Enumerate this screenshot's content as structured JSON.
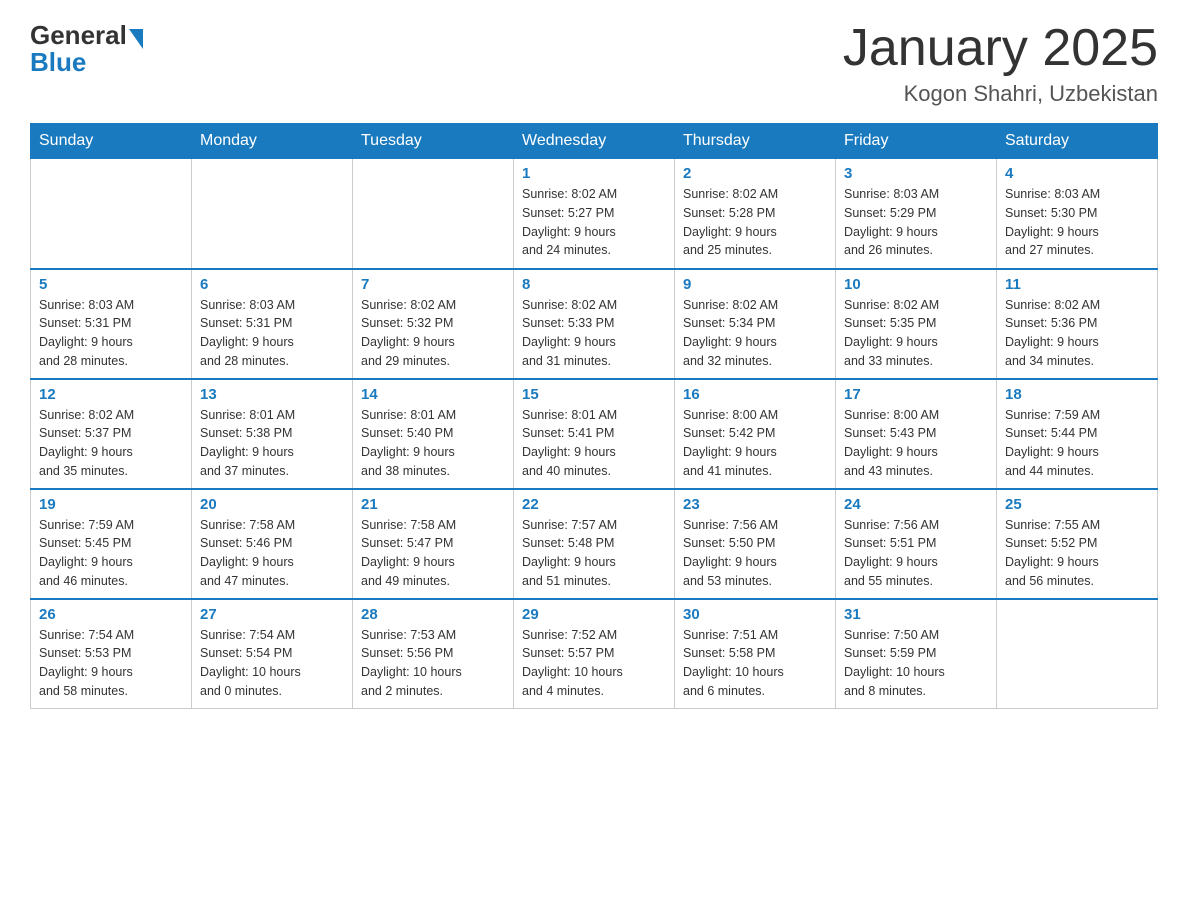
{
  "header": {
    "logo_general": "General",
    "logo_blue": "Blue",
    "title": "January 2025",
    "subtitle": "Kogon Shahri, Uzbekistan"
  },
  "columns": [
    "Sunday",
    "Monday",
    "Tuesday",
    "Wednesday",
    "Thursday",
    "Friday",
    "Saturday"
  ],
  "weeks": [
    [
      {
        "day": "",
        "info": ""
      },
      {
        "day": "",
        "info": ""
      },
      {
        "day": "",
        "info": ""
      },
      {
        "day": "1",
        "info": "Sunrise: 8:02 AM\nSunset: 5:27 PM\nDaylight: 9 hours\nand 24 minutes."
      },
      {
        "day": "2",
        "info": "Sunrise: 8:02 AM\nSunset: 5:28 PM\nDaylight: 9 hours\nand 25 minutes."
      },
      {
        "day": "3",
        "info": "Sunrise: 8:03 AM\nSunset: 5:29 PM\nDaylight: 9 hours\nand 26 minutes."
      },
      {
        "day": "4",
        "info": "Sunrise: 8:03 AM\nSunset: 5:30 PM\nDaylight: 9 hours\nand 27 minutes."
      }
    ],
    [
      {
        "day": "5",
        "info": "Sunrise: 8:03 AM\nSunset: 5:31 PM\nDaylight: 9 hours\nand 28 minutes."
      },
      {
        "day": "6",
        "info": "Sunrise: 8:03 AM\nSunset: 5:31 PM\nDaylight: 9 hours\nand 28 minutes."
      },
      {
        "day": "7",
        "info": "Sunrise: 8:02 AM\nSunset: 5:32 PM\nDaylight: 9 hours\nand 29 minutes."
      },
      {
        "day": "8",
        "info": "Sunrise: 8:02 AM\nSunset: 5:33 PM\nDaylight: 9 hours\nand 31 minutes."
      },
      {
        "day": "9",
        "info": "Sunrise: 8:02 AM\nSunset: 5:34 PM\nDaylight: 9 hours\nand 32 minutes."
      },
      {
        "day": "10",
        "info": "Sunrise: 8:02 AM\nSunset: 5:35 PM\nDaylight: 9 hours\nand 33 minutes."
      },
      {
        "day": "11",
        "info": "Sunrise: 8:02 AM\nSunset: 5:36 PM\nDaylight: 9 hours\nand 34 minutes."
      }
    ],
    [
      {
        "day": "12",
        "info": "Sunrise: 8:02 AM\nSunset: 5:37 PM\nDaylight: 9 hours\nand 35 minutes."
      },
      {
        "day": "13",
        "info": "Sunrise: 8:01 AM\nSunset: 5:38 PM\nDaylight: 9 hours\nand 37 minutes."
      },
      {
        "day": "14",
        "info": "Sunrise: 8:01 AM\nSunset: 5:40 PM\nDaylight: 9 hours\nand 38 minutes."
      },
      {
        "day": "15",
        "info": "Sunrise: 8:01 AM\nSunset: 5:41 PM\nDaylight: 9 hours\nand 40 minutes."
      },
      {
        "day": "16",
        "info": "Sunrise: 8:00 AM\nSunset: 5:42 PM\nDaylight: 9 hours\nand 41 minutes."
      },
      {
        "day": "17",
        "info": "Sunrise: 8:00 AM\nSunset: 5:43 PM\nDaylight: 9 hours\nand 43 minutes."
      },
      {
        "day": "18",
        "info": "Sunrise: 7:59 AM\nSunset: 5:44 PM\nDaylight: 9 hours\nand 44 minutes."
      }
    ],
    [
      {
        "day": "19",
        "info": "Sunrise: 7:59 AM\nSunset: 5:45 PM\nDaylight: 9 hours\nand 46 minutes."
      },
      {
        "day": "20",
        "info": "Sunrise: 7:58 AM\nSunset: 5:46 PM\nDaylight: 9 hours\nand 47 minutes."
      },
      {
        "day": "21",
        "info": "Sunrise: 7:58 AM\nSunset: 5:47 PM\nDaylight: 9 hours\nand 49 minutes."
      },
      {
        "day": "22",
        "info": "Sunrise: 7:57 AM\nSunset: 5:48 PM\nDaylight: 9 hours\nand 51 minutes."
      },
      {
        "day": "23",
        "info": "Sunrise: 7:56 AM\nSunset: 5:50 PM\nDaylight: 9 hours\nand 53 minutes."
      },
      {
        "day": "24",
        "info": "Sunrise: 7:56 AM\nSunset: 5:51 PM\nDaylight: 9 hours\nand 55 minutes."
      },
      {
        "day": "25",
        "info": "Sunrise: 7:55 AM\nSunset: 5:52 PM\nDaylight: 9 hours\nand 56 minutes."
      }
    ],
    [
      {
        "day": "26",
        "info": "Sunrise: 7:54 AM\nSunset: 5:53 PM\nDaylight: 9 hours\nand 58 minutes."
      },
      {
        "day": "27",
        "info": "Sunrise: 7:54 AM\nSunset: 5:54 PM\nDaylight: 10 hours\nand 0 minutes."
      },
      {
        "day": "28",
        "info": "Sunrise: 7:53 AM\nSunset: 5:56 PM\nDaylight: 10 hours\nand 2 minutes."
      },
      {
        "day": "29",
        "info": "Sunrise: 7:52 AM\nSunset: 5:57 PM\nDaylight: 10 hours\nand 4 minutes."
      },
      {
        "day": "30",
        "info": "Sunrise: 7:51 AM\nSunset: 5:58 PM\nDaylight: 10 hours\nand 6 minutes."
      },
      {
        "day": "31",
        "info": "Sunrise: 7:50 AM\nSunset: 5:59 PM\nDaylight: 10 hours\nand 8 minutes."
      },
      {
        "day": "",
        "info": ""
      }
    ]
  ]
}
